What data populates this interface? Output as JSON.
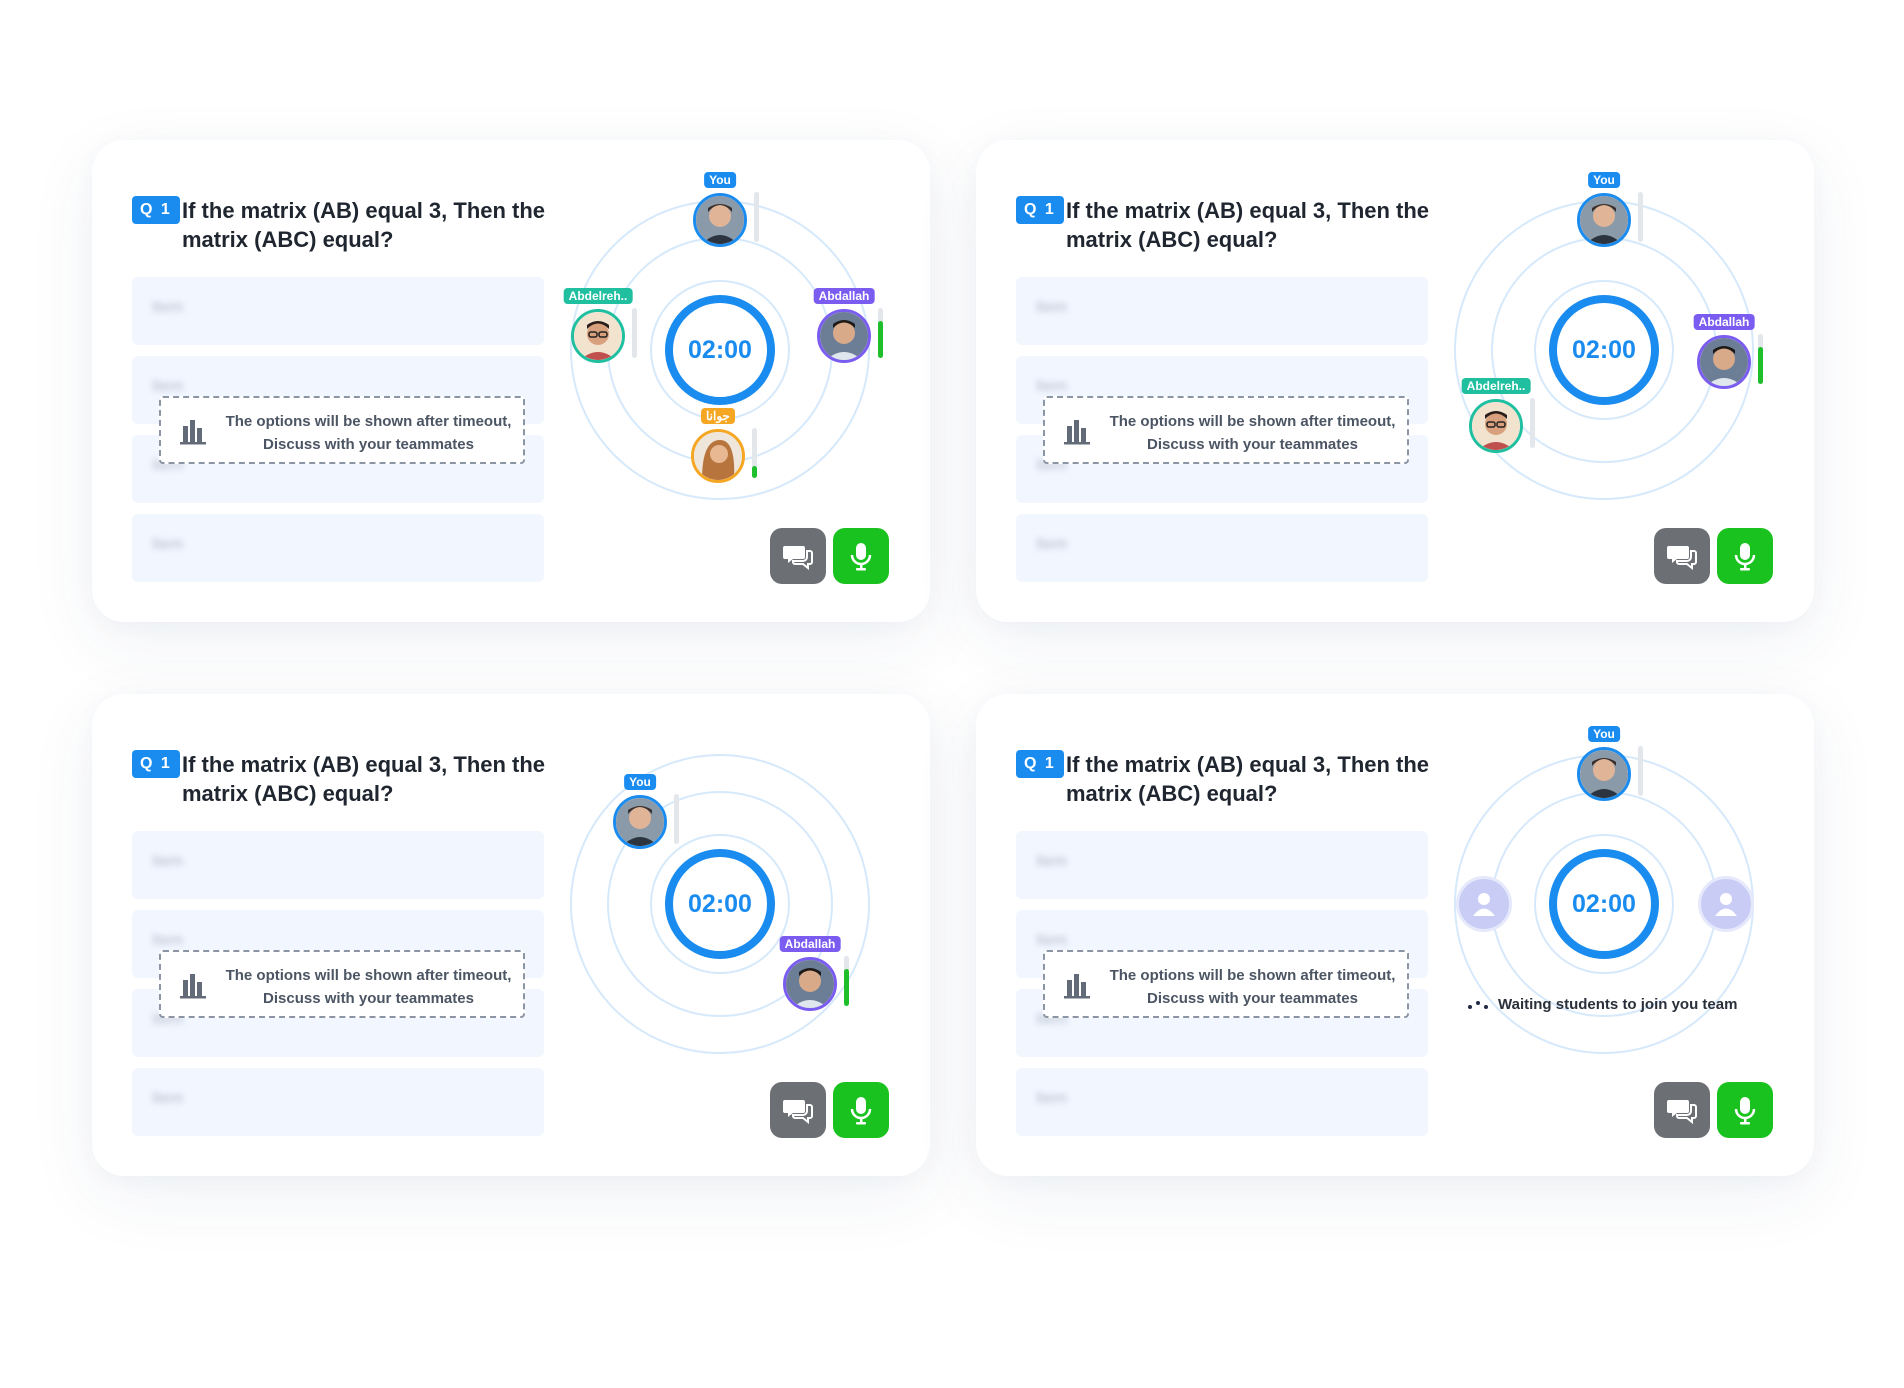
{
  "colors": {
    "primary": "#1a8cf0",
    "mic_button": "#1ac21f",
    "chat_button": "#6c6f74",
    "tag_you": "#1a8cf0",
    "tag_abdelreh": "#1fbfa0",
    "tag_abdallah": "#7b5cf0",
    "tag_orange": "#f5a623",
    "volume_active": "#1ebf2b"
  },
  "cards": [
    {
      "question": {
        "badge": "Q 1",
        "text": "If the matrix (AB) equal 3, Then the matrix (ABC) equal?"
      },
      "options": [
        "Item",
        "Item",
        "Item",
        "Item"
      ],
      "notice": {
        "icon": "bar-chart-icon",
        "text": "The options will be shown after timeout, Discuss with your teammates"
      },
      "timer": "02:00",
      "members": [
        {
          "name": "You",
          "volume": 0
        },
        {
          "name": "Abdelreh..",
          "volume": 0
        },
        {
          "name": "Abdallah",
          "volume": 0.75
        },
        {
          "name": "جوانا",
          "volume": 0.25
        }
      ],
      "actions": {
        "chat_icon": "chat-icon",
        "mic_icon": "microphone-icon"
      }
    },
    {
      "question": {
        "badge": "Q 1",
        "text": "If the matrix (AB) equal 3, Then the matrix (ABC) equal?"
      },
      "options": [
        "Item",
        "Item",
        "Item",
        "Item"
      ],
      "notice": {
        "icon": "bar-chart-icon",
        "text": "The options will be shown after timeout, Discuss with your teammates"
      },
      "timer": "02:00",
      "members": [
        {
          "name": "You",
          "volume": 0
        },
        {
          "name": "Abdallah",
          "volume": 0.75
        },
        {
          "name": "Abdelreh..",
          "volume": 0
        }
      ],
      "actions": {
        "chat_icon": "chat-icon",
        "mic_icon": "microphone-icon"
      }
    },
    {
      "question": {
        "badge": "Q 1",
        "text": "If the matrix (AB) equal 3, Then the matrix (ABC) equal?"
      },
      "options": [
        "Item",
        "Item",
        "Item",
        "Item"
      ],
      "notice": {
        "icon": "bar-chart-icon",
        "text": "The options will be shown after timeout, Discuss with your teammates"
      },
      "timer": "02:00",
      "members": [
        {
          "name": "You",
          "volume": 0
        },
        {
          "name": "Abdallah",
          "volume": 0.75
        }
      ],
      "actions": {
        "chat_icon": "chat-icon",
        "mic_icon": "microphone-icon"
      }
    },
    {
      "question": {
        "badge": "Q 1",
        "text": "If the matrix (AB) equal 3, Then the matrix (ABC) equal?"
      },
      "options": [
        "Item",
        "Item",
        "Item",
        "Item"
      ],
      "notice": {
        "icon": "bar-chart-icon",
        "text": "The options will be shown after timeout, Discuss with your teammates"
      },
      "timer": "02:00",
      "members": [
        {
          "name": "You",
          "volume": 0
        }
      ],
      "placeholders": [
        "user-placeholder-icon",
        "user-placeholder-icon"
      ],
      "waiting_text": "Waiting students to join you team",
      "actions": {
        "chat_icon": "chat-icon",
        "mic_icon": "microphone-icon"
      }
    }
  ]
}
